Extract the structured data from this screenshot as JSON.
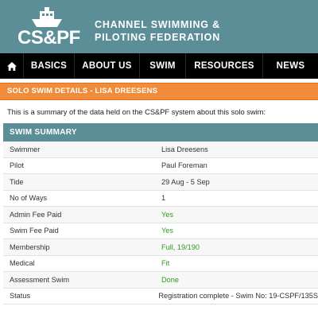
{
  "header": {
    "logo_text": "CS&PF",
    "org_name_line1": "CHANNEL SWIMMING &",
    "org_name_line2": "PILOTING FEDERATION"
  },
  "nav": {
    "home_icon": "home-icon",
    "items": [
      "BASICS",
      "ABOUT US",
      "SWIM",
      "RESOURCES",
      "NEWS"
    ]
  },
  "page": {
    "title": "SOLO SWIM DETAILS - LISA DREESENS",
    "intro": "This is a summary of the data held on the CS&PF system about this solo swim:",
    "summary_heading": "SWIM SUMMARY"
  },
  "summary": [
    {
      "label": "Swimmer",
      "value": "Lisa Dreesens",
      "status": "normal"
    },
    {
      "label": "Pilot",
      "value": "Paul Foreman",
      "status": "normal"
    },
    {
      "label": "Tide",
      "value": "29 Aug - 5 Sep",
      "status": "normal"
    },
    {
      "label": "No of Ways",
      "value": "1",
      "status": "normal"
    },
    {
      "label": "Admin Fee Paid",
      "value": "Yes",
      "status": "ok"
    },
    {
      "label": "Swim Fee Paid",
      "value": "Yes",
      "status": "ok"
    },
    {
      "label": "Membership",
      "value": "Full, 19/190",
      "status": "ok"
    },
    {
      "label": "Medical",
      "value": "Fit",
      "status": "ok"
    },
    {
      "label": "Assessment Swim",
      "value": "Done",
      "status": "ok"
    },
    {
      "label": "Status",
      "value": "Registration complete - Swim No: 19-CSPF/135S",
      "status": "normal"
    }
  ],
  "colors": {
    "brand_teal": "#5b8e97",
    "title_orange": "#f08c3a",
    "ok_green": "#2e9a1c"
  }
}
